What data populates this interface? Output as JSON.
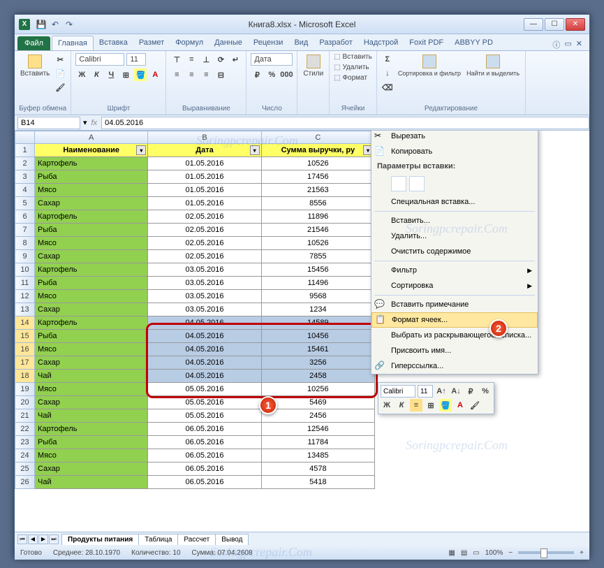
{
  "window": {
    "title": "Книга8.xlsx - Microsoft Excel",
    "min": "—",
    "max": "☐",
    "close": "✕"
  },
  "ribbon_tabs": {
    "file": "Файл",
    "tabs": [
      "Главная",
      "Вставка",
      "Размет",
      "Формул",
      "Данные",
      "Рецензи",
      "Вид",
      "Разработ",
      "Надстрой",
      "Foxit PDF",
      "ABBYY PD"
    ],
    "active": 0
  },
  "ribbon": {
    "clipboard": {
      "paste": "Вставить",
      "label": "Буфер обмена"
    },
    "font": {
      "name": "Calibri",
      "size": "11",
      "label": "Шрифт"
    },
    "align": {
      "label": "Выравнивание"
    },
    "number": {
      "format": "Дата",
      "label": "Число"
    },
    "styles": {
      "btn": "Стили"
    },
    "cells": {
      "insert": "Вставить",
      "delete": "Удалить",
      "format": "Формат",
      "label": "Ячейки"
    },
    "editing": {
      "sort": "Сортировка и фильтр",
      "find": "Найти и выделить",
      "label": "Редактирование"
    }
  },
  "namebox": "B14",
  "formula": "04.05.2016",
  "columns": [
    "A",
    "B",
    "C"
  ],
  "headers": [
    "Наименование",
    "Дата",
    "Сумма выручки, ру"
  ],
  "rows": [
    {
      "n": 2,
      "a": "Картофель",
      "b": "01.05.2016",
      "c": "10526"
    },
    {
      "n": 3,
      "a": "Рыба",
      "b": "01.05.2016",
      "c": "17456"
    },
    {
      "n": 4,
      "a": "Мясо",
      "b": "01.05.2016",
      "c": "21563"
    },
    {
      "n": 5,
      "a": "Сахар",
      "b": "01.05.2016",
      "c": "8556"
    },
    {
      "n": 6,
      "a": "Картофель",
      "b": "02.05.2016",
      "c": "11896"
    },
    {
      "n": 7,
      "a": "Рыба",
      "b": "02.05.2016",
      "c": "21546"
    },
    {
      "n": 8,
      "a": "Мясо",
      "b": "02.05.2016",
      "c": "10526"
    },
    {
      "n": 9,
      "a": "Сахар",
      "b": "02.05.2016",
      "c": "7855"
    },
    {
      "n": 10,
      "a": "Картофель",
      "b": "03.05.2016",
      "c": "15456"
    },
    {
      "n": 11,
      "a": "Рыба",
      "b": "03.05.2016",
      "c": "11496"
    },
    {
      "n": 12,
      "a": "Мясо",
      "b": "03.05.2016",
      "c": "9568"
    },
    {
      "n": 13,
      "a": "Сахар",
      "b": "03.05.2016",
      "c": "1234"
    },
    {
      "n": 14,
      "a": "Картофель",
      "b": "04.05.2016",
      "c": "14589",
      "sel": true
    },
    {
      "n": 15,
      "a": "Рыба",
      "b": "04.05.2016",
      "c": "10456",
      "sel": true
    },
    {
      "n": 16,
      "a": "Мясо",
      "b": "04.05.2016",
      "c": "15461",
      "sel": true
    },
    {
      "n": 17,
      "a": "Сахар",
      "b": "04.05.2016",
      "c": "3256",
      "sel": true
    },
    {
      "n": 18,
      "a": "Чай",
      "b": "04.05.2016",
      "c": "2458",
      "sel": true
    },
    {
      "n": 19,
      "a": "Мясо",
      "b": "05.05.2016",
      "c": "10256"
    },
    {
      "n": 20,
      "a": "Сахар",
      "b": "05.05.2016",
      "c": "5469"
    },
    {
      "n": 21,
      "a": "Чай",
      "b": "05.05.2016",
      "c": "2456"
    },
    {
      "n": 22,
      "a": "Картофель",
      "b": "06.05.2016",
      "c": "12546"
    },
    {
      "n": 23,
      "a": "Рыба",
      "b": "06.05.2016",
      "c": "11784"
    },
    {
      "n": 24,
      "a": "Мясо",
      "b": "06.05.2016",
      "c": "13485"
    },
    {
      "n": 25,
      "a": "Сахар",
      "b": "06.05.2016",
      "c": "4578"
    },
    {
      "n": 26,
      "a": "Чай",
      "b": "06.05.2016",
      "c": "5418"
    }
  ],
  "context_menu": {
    "cut": "Вырезать",
    "copy": "Копировать",
    "paste_options": "Параметры вставки:",
    "paste_special": "Специальная вставка...",
    "insert": "Вставить...",
    "delete": "Удалить...",
    "clear": "Очистить содержимое",
    "filter": "Фильтр",
    "sort": "Сортировка",
    "comment": "Вставить примечание",
    "format_cells": "Формат ячеек...",
    "dropdown": "Выбрать из раскрывающегося списка...",
    "name": "Присвоить имя...",
    "hyperlink": "Гиперссылка..."
  },
  "mini_toolbar": {
    "font": "Calibri",
    "size": "11"
  },
  "sheet_tabs": [
    "Продукты питания",
    "Таблица",
    "Рассчет",
    "Вывод"
  ],
  "statusbar": {
    "ready": "Готово",
    "avg_label": "Среднее:",
    "avg": "28.10.1970",
    "count_label": "Количество:",
    "count": "10",
    "sum_label": "Сумма:",
    "sum": "07.04.2608",
    "zoom": "100%"
  },
  "callouts": {
    "one": "1",
    "two": "2"
  },
  "watermark": "Soringpcrepair.Com"
}
